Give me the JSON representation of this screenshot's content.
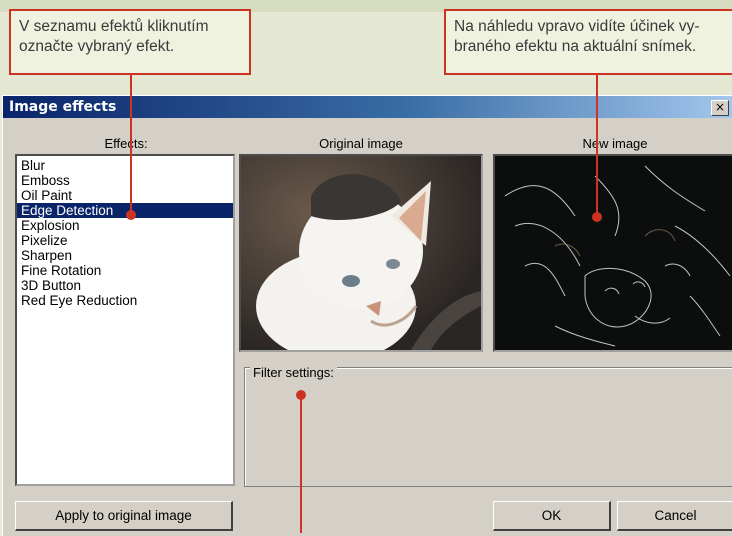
{
  "callouts": {
    "left": "V seznamu efektů kliknutím\noznačte vybraný efekt.",
    "right": "Na náhledu vpravo vidíte účinek vy-\nbraného efektu na aktuální snímek."
  },
  "window": {
    "title": "Image effects",
    "close_glyph": "×"
  },
  "labels": {
    "effects": "Effects:",
    "original": "Original image",
    "new": "New image",
    "filter_settings": "Filter settings:"
  },
  "effects": [
    {
      "label": "Blur",
      "selected": false
    },
    {
      "label": "Emboss",
      "selected": false
    },
    {
      "label": "Oil Paint",
      "selected": false
    },
    {
      "label": "Edge Detection",
      "selected": true
    },
    {
      "label": "Explosion",
      "selected": false
    },
    {
      "label": "Pixelize",
      "selected": false
    },
    {
      "label": "Sharpen",
      "selected": false
    },
    {
      "label": "Fine Rotation",
      "selected": false
    },
    {
      "label": "3D Button",
      "selected": false
    },
    {
      "label": "Red Eye Reduction",
      "selected": false
    }
  ],
  "buttons": {
    "apply": "Apply to original image",
    "ok": "OK",
    "cancel": "Cancel"
  },
  "colors": {
    "callout_border": "#cc3322",
    "selection": "#0a246a"
  }
}
